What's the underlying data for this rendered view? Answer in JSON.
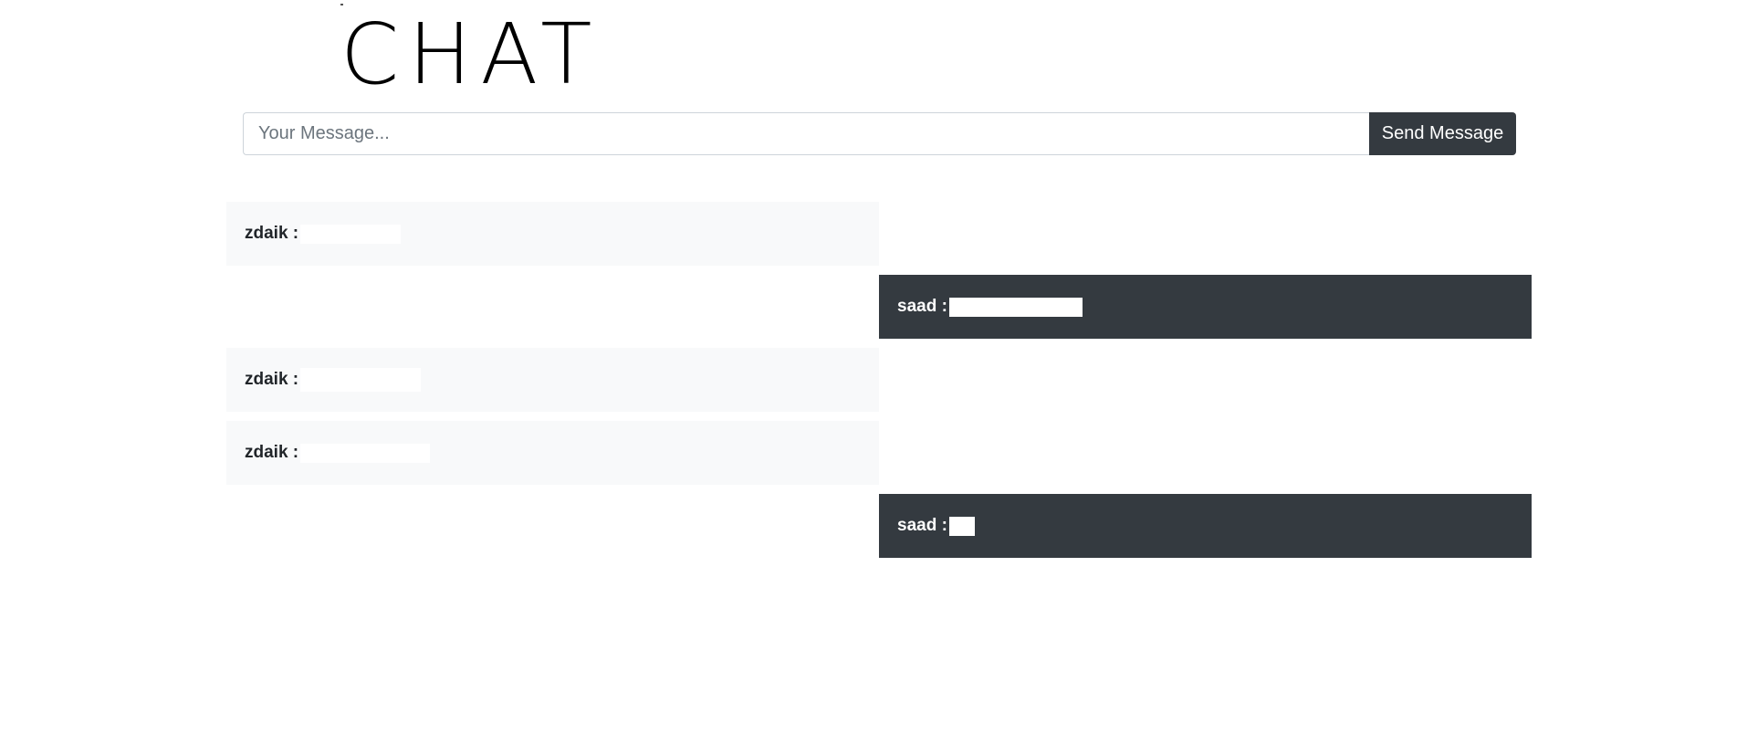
{
  "header": {
    "logo_text": "CHAT"
  },
  "composer": {
    "placeholder": "Your Message...",
    "value": "",
    "send_label": "Send Message"
  },
  "colors": {
    "own_message_bg": "#343a40",
    "other_message_bg": "#f8f9fa",
    "send_button_bg": "#343a40"
  },
  "messages": [
    {
      "author": "zdaik",
      "author_label": "zdaik :",
      "side": "left",
      "text_redacted": true
    },
    {
      "author": "saad",
      "author_label": "saad :",
      "side": "right",
      "text_redacted": true
    },
    {
      "author": "zdaik",
      "author_label": "zdaik :",
      "side": "left",
      "text_redacted": true
    },
    {
      "author": "zdaik",
      "author_label": "zdaik :",
      "side": "left",
      "text_redacted": true
    },
    {
      "author": "saad",
      "author_label": "saad :",
      "side": "right",
      "text_redacted": true
    }
  ]
}
